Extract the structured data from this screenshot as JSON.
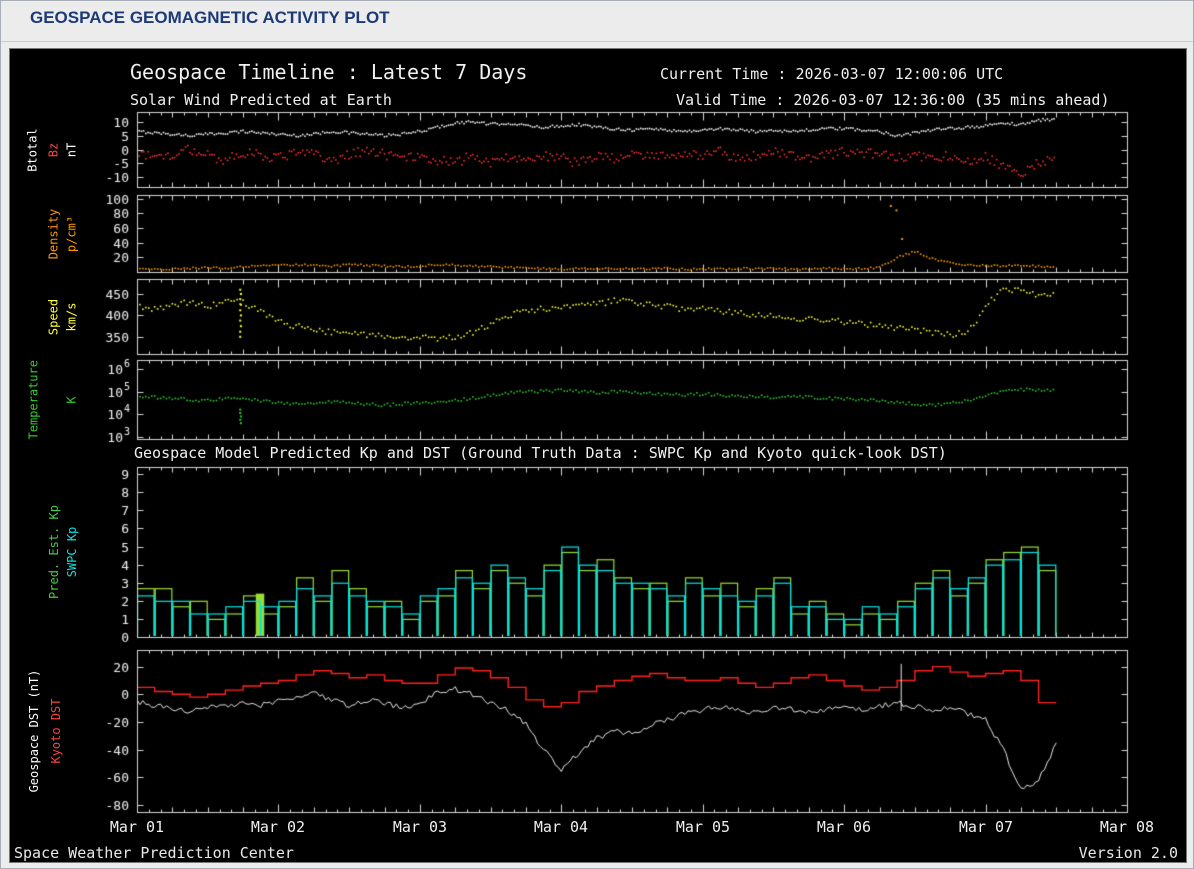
{
  "page": {
    "header_title": "GEOSPACE GEOMAGNETIC ACTIVITY PLOT"
  },
  "plot": {
    "title": "Geospace Timeline : Latest 7 Days",
    "subtitle": "Solar Wind Predicted at Earth",
    "current_time": "Current Time : 2026-03-07 12:00:06 UTC",
    "valid_time": "Valid Time : 2026-03-07 12:36:00 (35 mins ahead)",
    "section2_title": "Geospace Model Predicted Kp and DST (Ground Truth Data : SWPC Kp and Kyoto quick-look DST)",
    "footer_left": "Space Weather Prediction Center",
    "footer_right": "Version 2.0",
    "x_tick_labels": [
      "Mar 01",
      "Mar 02",
      "Mar 03",
      "Mar 04",
      "Mar 05",
      "Mar 06",
      "Mar 07",
      "Mar 08"
    ],
    "frame_color": "#d9d9d9",
    "background": "#000000",
    "tick_label_color": "#f0f0f0"
  },
  "chart_data": [
    {
      "id": "bt_bz",
      "type": "scatter",
      "description": "Solar wind magnetic field at Earth, Btotal (white) and Bz (red), nT, Mar 01 00:00 to Mar 07 12:00 UTC, sampled every 3 hours",
      "ylim": [
        -13.5,
        13.5
      ],
      "yticks": [
        {
          "v": 10,
          "label": "10"
        },
        {
          "v": 5,
          "label": "5"
        },
        {
          "v": 0,
          "label": "0"
        },
        {
          "v": -5,
          "label": "-5"
        },
        {
          "v": -10,
          "label": "-10"
        }
      ],
      "ylabels": [
        {
          "text": "Btotal",
          "color": "#ffffff"
        },
        {
          "text": "Bz",
          "color": "#ff4040"
        },
        {
          "text": "nT",
          "color": "#ffffff"
        }
      ],
      "sample_step_days": 0.125,
      "series": [
        {
          "name": "Btotal",
          "color": "#f5f5f5",
          "style": "scatter",
          "jitter": 0.5,
          "density": 8,
          "values": [
            6.5,
            6,
            5.5,
            5,
            5.5,
            6,
            6.5,
            6,
            5.5,
            5,
            5.5,
            6.5,
            6,
            5.5,
            5,
            5.5,
            6.5,
            8,
            9.5,
            10,
            9,
            9.5,
            8.5,
            8,
            8.5,
            9,
            8,
            7.5,
            7,
            7.5,
            7,
            6.5,
            7,
            7.5,
            7,
            6.5,
            7,
            6.5,
            7,
            7.5,
            7.5,
            7,
            6.5,
            5,
            6,
            7,
            7.5,
            8,
            8.5,
            9.5,
            9,
            10.5,
            11
          ]
        },
        {
          "name": "Bz",
          "color": "#ff3030",
          "style": "scatter",
          "jitter": 1.8,
          "density": 8,
          "values": [
            -1,
            -3,
            -2,
            0,
            -2,
            -4,
            -1,
            -2,
            -3,
            -1,
            -2,
            -4,
            -2,
            0,
            -2,
            -3,
            -2,
            -4,
            -5,
            -2,
            -5,
            -3,
            -4,
            -2,
            -3,
            -5,
            -2,
            -3,
            -1,
            -3,
            -2,
            -1,
            -2,
            -1,
            -3,
            -2,
            -1,
            -2,
            -3,
            -2,
            -1,
            -2,
            -1,
            -3,
            -2,
            -3,
            -2,
            -4,
            -3,
            -6,
            -9,
            -5,
            -2
          ]
        }
      ]
    },
    {
      "id": "density",
      "type": "scatter",
      "description": "Solar wind proton density, p/cm3, sampled every 3 hours",
      "ylim": [
        0,
        105
      ],
      "yticks": [
        {
          "v": 100,
          "label": "100"
        },
        {
          "v": 80,
          "label": "80"
        },
        {
          "v": 60,
          "label": "60"
        },
        {
          "v": 40,
          "label": "40"
        },
        {
          "v": 20,
          "label": "20"
        }
      ],
      "ylabels": [
        {
          "text": "Density",
          "color": "#ff9900"
        },
        {
          "text": "p/cm³",
          "color": "#ff9900"
        }
      ],
      "sample_step_days": 0.125,
      "series": [
        {
          "name": "Density",
          "color": "#ff9900",
          "style": "scatter",
          "jitter": 1.3,
          "density": 6,
          "values": [
            5,
            4,
            4,
            5,
            6,
            5,
            7,
            8,
            9,
            10,
            9,
            8,
            10,
            9,
            8,
            7,
            8,
            10,
            9,
            8,
            7,
            6,
            5,
            5,
            4,
            5,
            4,
            5,
            4,
            4,
            5,
            4,
            4,
            4,
            5,
            4,
            5,
            4,
            4,
            5,
            4,
            5,
            6,
            20,
            28,
            18,
            12,
            10,
            9,
            8,
            9,
            8,
            7
          ],
          "outliers": [
            [
              5.33,
              90
            ],
            [
              5.37,
              84
            ],
            [
              5.41,
              45
            ]
          ]
        }
      ]
    },
    {
      "id": "speed",
      "type": "scatter",
      "description": "Solar wind speed, km/s, sampled every 3 hours",
      "ylim": [
        310,
        485
      ],
      "yticks": [
        {
          "v": 450,
          "label": "450"
        },
        {
          "v": 400,
          "label": "400"
        },
        {
          "v": 350,
          "label": "350"
        }
      ],
      "ylabels": [
        {
          "text": "Speed",
          "color": "#ffff33"
        },
        {
          "text": "km/s",
          "color": "#ffff33"
        }
      ],
      "sample_step_days": 0.125,
      "series": [
        {
          "name": "Speed",
          "color": "#ffff33",
          "style": "scatter",
          "jitter": 7,
          "density": 6,
          "values": [
            420,
            415,
            425,
            430,
            420,
            435,
            430,
            410,
            385,
            375,
            365,
            360,
            355,
            355,
            350,
            350,
            350,
            345,
            350,
            360,
            380,
            400,
            410,
            415,
            420,
            430,
            425,
            435,
            430,
            425,
            420,
            415,
            415,
            410,
            405,
            400,
            400,
            395,
            390,
            390,
            385,
            380,
            375,
            370,
            365,
            360,
            355,
            360,
            420,
            465,
            455,
            445,
            450
          ],
          "outliers": [
            [
              0.73,
              350
            ],
            [
              0.73,
              362
            ],
            [
              0.735,
              375
            ],
            [
              0.73,
              388
            ],
            [
              0.735,
              400
            ],
            [
              0.73,
              412
            ],
            [
              0.735,
              425
            ],
            [
              0.73,
              438
            ],
            [
              0.735,
              450
            ],
            [
              0.73,
              460
            ]
          ]
        }
      ]
    },
    {
      "id": "temperature",
      "type": "scatter",
      "log_scale": true,
      "description": "Solar wind temperature, K, values given as log10(K), sampled every 3 hours",
      "ylim": [
        2.9,
        6.4
      ],
      "yticks": [
        {
          "v": 6,
          "label": "10",
          "sup": "6"
        },
        {
          "v": 5,
          "label": "10",
          "sup": "5"
        },
        {
          "v": 4,
          "label": "10",
          "sup": "4"
        },
        {
          "v": 3,
          "label": "10",
          "sup": "3"
        }
      ],
      "ylabels": [
        {
          "text": "Temperature",
          "color": "#2ecc2e"
        },
        {
          "text": "K",
          "color": "#2ecc2e"
        }
      ],
      "sample_step_days": 0.125,
      "series": [
        {
          "name": "Temperature",
          "color": "#2ecc2e",
          "style": "scatter",
          "jitter": 0.07,
          "density": 6,
          "values": [
            4.8,
            4.75,
            4.7,
            4.65,
            4.6,
            4.7,
            4.75,
            4.6,
            4.5,
            4.45,
            4.5,
            4.55,
            4.5,
            4.45,
            4.4,
            4.45,
            4.5,
            4.55,
            4.6,
            4.7,
            4.85,
            4.95,
            5.0,
            5.0,
            5.05,
            5.0,
            4.95,
            5.0,
            4.95,
            4.9,
            4.9,
            4.85,
            4.9,
            4.85,
            4.8,
            4.8,
            4.75,
            4.8,
            4.75,
            4.7,
            4.7,
            4.65,
            4.6,
            4.5,
            4.45,
            4.4,
            4.5,
            4.6,
            4.8,
            5.0,
            5.1,
            5.05,
            5.1
          ],
          "outliers": [
            [
              0.73,
              4.2
            ],
            [
              0.73,
              4.05
            ],
            [
              0.735,
              3.9
            ],
            [
              0.73,
              3.75
            ],
            [
              0.735,
              3.6
            ]
          ]
        }
      ]
    },
    {
      "id": "kp",
      "type": "bar",
      "description": "Geospace model predicted estimated Kp (green) and SWPC Kp (cyan), 3-hour bins, Mar 01 to Mar 07 12:00 UTC",
      "ylim": [
        0,
        9.4
      ],
      "yticks": [
        {
          "v": 9,
          "label": "9"
        },
        {
          "v": 8,
          "label": "8"
        },
        {
          "v": 7,
          "label": "7"
        },
        {
          "v": 6,
          "label": "6"
        },
        {
          "v": 5,
          "label": "5"
        },
        {
          "v": 4,
          "label": "4"
        },
        {
          "v": 3,
          "label": "3"
        },
        {
          "v": 2,
          "label": "2"
        },
        {
          "v": 1,
          "label": "1"
        },
        {
          "v": 0,
          "label": "0"
        }
      ],
      "ylabels": [
        {
          "text": "Pred. Est. Kp",
          "color": "#44cc44"
        },
        {
          "text": "SWPC Kp",
          "color": "#00e6e6"
        }
      ],
      "sample_step_days": 0.125,
      "series": [
        {
          "name": "Pred. Est. Kp",
          "color": "#99dd33",
          "style": "kp-bars",
          "values": [
            2.7,
            2.7,
            1.7,
            2.0,
            1.0,
            1.3,
            2.3,
            1.3,
            1.7,
            3.3,
            2.0,
            3.7,
            2.7,
            1.7,
            2.0,
            1.0,
            2.0,
            2.3,
            3.7,
            2.7,
            3.7,
            3.0,
            2.3,
            4.0,
            4.7,
            3.7,
            4.3,
            3.3,
            2.7,
            3.0,
            2.0,
            3.3,
            2.3,
            3.0,
            1.7,
            2.7,
            3.3,
            1.3,
            2.0,
            1.3,
            0.7,
            1.3,
            1.0,
            2.0,
            3.0,
            3.7,
            2.3,
            3.0,
            4.3,
            4.7,
            5.0,
            3.7
          ],
          "solid": [
            {
              "x0": 0.84,
              "x1": 0.9,
              "v": 2.4
            }
          ]
        },
        {
          "name": "SWPC Kp",
          "color": "#00e6e6",
          "style": "kp-bars",
          "values": [
            2.3,
            2.0,
            2.0,
            1.3,
            1.3,
            1.7,
            2.0,
            1.7,
            2.0,
            2.7,
            2.3,
            3.0,
            2.3,
            2.0,
            1.7,
            1.3,
            2.3,
            2.7,
            3.3,
            3.0,
            4.0,
            3.3,
            2.7,
            3.7,
            5.0,
            4.0,
            3.7,
            3.0,
            3.0,
            2.7,
            2.3,
            3.0,
            2.7,
            2.3,
            2.0,
            2.3,
            3.0,
            1.7,
            1.7,
            1.0,
            1.0,
            1.7,
            1.3,
            1.7,
            2.7,
            3.3,
            2.7,
            3.3,
            4.0,
            4.3,
            4.7,
            4.0
          ]
        }
      ]
    },
    {
      "id": "dst",
      "type": "line",
      "description": "Geospace model DST (white) and Kyoto quick-look DST (red), nT, sampled every 3 hours",
      "ylim": [
        -85,
        32
      ],
      "yticks": [
        {
          "v": 20,
          "label": "20"
        },
        {
          "v": 0,
          "label": "0"
        },
        {
          "v": -20,
          "label": "-20"
        },
        {
          "v": -40,
          "label": "-40"
        },
        {
          "v": -60,
          "label": "-60"
        },
        {
          "v": -80,
          "label": "-80"
        }
      ],
      "ylabels": [
        {
          "text": "Geospace DST (nT)",
          "color": "#ffffff"
        },
        {
          "text": "Kyoto DST",
          "color": "#ff4040"
        }
      ],
      "sample_step_days": 0.125,
      "series": [
        {
          "name": "Kyoto DST",
          "color": "#ff2020",
          "style": "step",
          "values": [
            5,
            2,
            0,
            -2,
            0,
            3,
            6,
            8,
            10,
            14,
            17,
            15,
            12,
            14,
            10,
            8,
            8,
            14,
            19,
            17,
            12,
            5,
            -4,
            -9,
            -6,
            2,
            6,
            10,
            13,
            15,
            12,
            10,
            10,
            12,
            8,
            5,
            8,
            12,
            14,
            10,
            6,
            3,
            5,
            10,
            17,
            20,
            16,
            13,
            15,
            17,
            10,
            -6,
            -12
          ]
        },
        {
          "name": "Geospace DST",
          "color": "#e8e8e8",
          "style": "noisy-line",
          "noise": 2.0,
          "values": [
            -5,
            -8,
            -11,
            -12,
            -10,
            -8,
            -6,
            -8,
            -5,
            -1,
            1,
            -4,
            -8,
            -4,
            -6,
            -10,
            -6,
            1,
            4,
            0,
            -6,
            -12,
            -22,
            -40,
            -55,
            -42,
            -32,
            -26,
            -29,
            -22,
            -18,
            -14,
            -11,
            -9,
            -11,
            -13,
            -9,
            -11,
            -13,
            -11,
            -9,
            -11,
            -9,
            -6,
            -9,
            -11,
            -10,
            -14,
            -18,
            -40,
            -68,
            -62,
            -35
          ],
          "spikes": [
            {
              "x": 5.4,
              "y0": -12,
              "y1": 22
            }
          ]
        }
      ]
    }
  ]
}
